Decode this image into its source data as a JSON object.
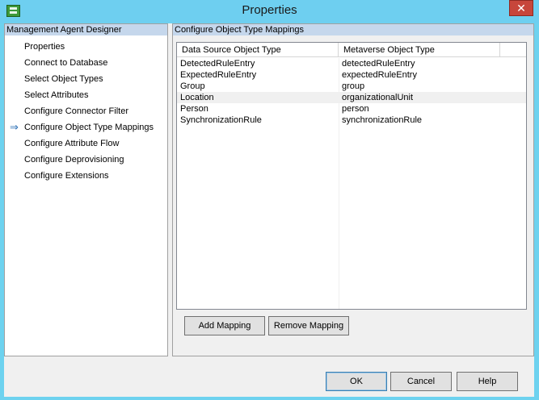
{
  "window": {
    "title": "Properties",
    "close_label": "✕"
  },
  "sidebar": {
    "header": "Management Agent Designer",
    "current_marker": "⇒",
    "items": [
      {
        "label": "Properties"
      },
      {
        "label": "Connect to Database"
      },
      {
        "label": "Select Object Types"
      },
      {
        "label": "Select Attributes"
      },
      {
        "label": "Configure Connector Filter"
      },
      {
        "label": "Configure Object Type Mappings",
        "current": true
      },
      {
        "label": "Configure Attribute Flow"
      },
      {
        "label": "Configure Deprovisioning"
      },
      {
        "label": "Configure Extensions"
      }
    ]
  },
  "main": {
    "header": "Configure Object Type Mappings",
    "columns": [
      "Data Source Object Type",
      "Metaverse Object Type"
    ],
    "rows": [
      [
        "DetectedRuleEntry",
        "detectedRuleEntry"
      ],
      [
        "ExpectedRuleEntry",
        "expectedRuleEntry"
      ],
      [
        "Group",
        "group"
      ],
      [
        "Location",
        "organizationalUnit"
      ],
      [
        "Person",
        "person"
      ],
      [
        "SynchronizationRule",
        "synchronizationRule"
      ]
    ],
    "selected_row": 3,
    "add_label": "Add Mapping",
    "remove_label": "Remove Mapping"
  },
  "footer": {
    "ok_label": "OK",
    "cancel_label": "Cancel",
    "help_label": "Help"
  },
  "icons": {
    "app": "window-app-icon",
    "close": "close-icon",
    "current": "arrow-right-icon"
  },
  "colors": {
    "titlebar": "#6ecff0",
    "pane_header": "#c5d7ec",
    "close": "#c7463b"
  }
}
